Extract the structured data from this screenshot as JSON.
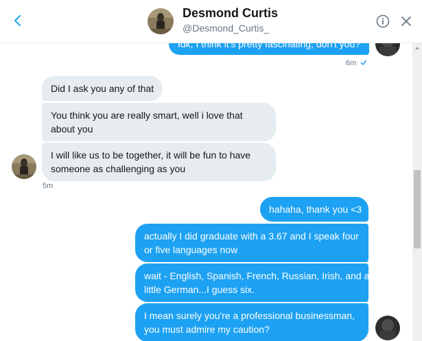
{
  "header": {
    "name": "Desmond Curtis",
    "handle": "@Desmond_Curtis_"
  },
  "messages": {
    "top_partial": "Idk, I think it's pretty fascinating, don't you?",
    "top_time": "6m",
    "incoming": [
      "Did I ask you any of that",
      "You think you are really smart, well i love that about you",
      "I will like us to be together, it will be fun to have someone as challenging as you"
    ],
    "incoming_lines": {
      "m2_l1": "You think you are really smart, well i love that",
      "m2_l2": "about you",
      "m3_l1": "I will like us to be together, it will be fun to have",
      "m3_l2": "someone as challenging as you"
    },
    "incoming_time": "5m",
    "outgoing": {
      "o1": "hahaha, thank you <3",
      "o2_l1": "actually I did graduate with a 3.67 and I speak four",
      "o2_l2": "or five languages now",
      "o3_l1": "wait - English, Spanish, French, Russian, Irish, and a",
      "o3_l2": "little German...I guess six.",
      "o4_l1": "I mean surely you're a professional businessman,",
      "o4_l2": "you must admire my caution?"
    }
  },
  "colors": {
    "outgoing_bubble": "#1da1f2",
    "incoming_bubble": "#e6ecf0",
    "accent": "#1da1f2"
  },
  "icons": [
    "chevron-left-icon",
    "info-icon",
    "close-icon",
    "read-check-icon",
    "scroll-up-arrow-icon"
  ]
}
